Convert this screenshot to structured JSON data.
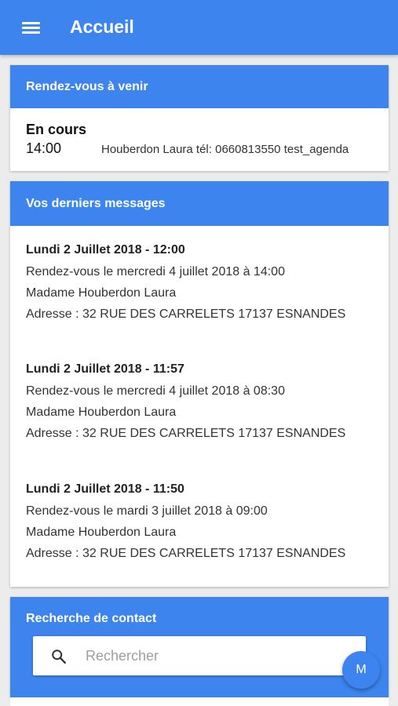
{
  "appbar": {
    "title": "Accueil",
    "menu_icon": "hamburger-menu-icon"
  },
  "upcoming": {
    "header": "Rendez-vous à venir",
    "status": "En cours",
    "time": "14:00",
    "description": "Houberdon Laura tél: 0660813550 test_agenda"
  },
  "messages": {
    "header": "Vos derniers messages",
    "items": [
      {
        "date": "Lundi 2 Juillet 2018 - 12:00",
        "rdv": "Rendez-vous le mercredi 4 juillet 2018 à 14:00",
        "name": "Madame Houberdon Laura",
        "address": "Adresse : 32 RUE DES CARRELETS 17137 ESNANDES"
      },
      {
        "date": "Lundi 2 Juillet 2018 - 11:57",
        "rdv": "Rendez-vous le mercredi 4 juillet 2018 à 08:30",
        "name": "Madame Houberdon Laura",
        "address": "Adresse : 32 RUE DES CARRELETS 17137 ESNANDES"
      },
      {
        "date": "Lundi 2 Juillet 2018 - 11:50",
        "rdv": "Rendez-vous le mardi 3 juillet 2018 à 09:00",
        "name": "Madame Houberdon Laura",
        "address": "Adresse : 32 RUE DES CARRELETS 17137 ESNANDES"
      }
    ]
  },
  "search": {
    "header": "Recherche de contact",
    "placeholder": "Rechercher",
    "value": ""
  },
  "fab": {
    "label": "M"
  },
  "colors": {
    "primary": "#3d84ee",
    "background": "#ececec"
  }
}
